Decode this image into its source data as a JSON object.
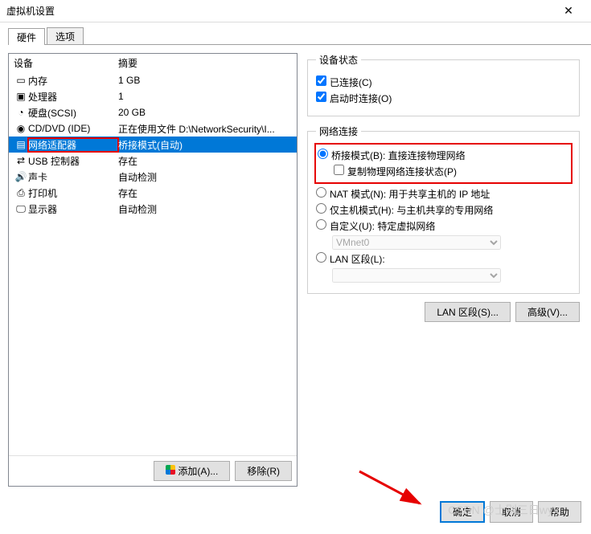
{
  "title": "虚拟机设置",
  "tabs": {
    "hardware": "硬件",
    "options": "选项"
  },
  "columns": {
    "device": "设备",
    "summary": "摘要"
  },
  "hardware": [
    {
      "icon": "memory",
      "device": "内存",
      "summary": "1 GB"
    },
    {
      "icon": "cpu",
      "device": "处理器",
      "summary": "1"
    },
    {
      "icon": "disk",
      "device": "硬盘(SCSI)",
      "summary": "20 GB"
    },
    {
      "icon": "cd",
      "device": "CD/DVD (IDE)",
      "summary": "正在使用文件 D:\\NetworkSecurity\\I..."
    },
    {
      "icon": "net",
      "device": "网络适配器",
      "summary": "桥接模式(自动)",
      "selected": true,
      "boxed": true
    },
    {
      "icon": "usb",
      "device": "USB 控制器",
      "summary": "存在"
    },
    {
      "icon": "sound",
      "device": "声卡",
      "summary": "自动检测"
    },
    {
      "icon": "printer",
      "device": "打印机",
      "summary": "存在"
    },
    {
      "icon": "display",
      "device": "显示器",
      "summary": "自动检测"
    }
  ],
  "buttons": {
    "add": "添加(A)...",
    "remove": "移除(R)",
    "lan": "LAN 区段(S)...",
    "advanced": "高级(V)..."
  },
  "status": {
    "legend": "设备状态",
    "connected": "已连接(C)",
    "connect_on_start": "启动时连接(O)"
  },
  "netconn": {
    "legend": "网络连接",
    "bridged": "桥接模式(B): 直接连接物理网络",
    "replicate": "复制物理网络连接状态(P)",
    "nat": "NAT 模式(N): 用于共享主机的 IP 地址",
    "hostonly": "仅主机模式(H): 与主机共享的专用网络",
    "custom": "自定义(U): 特定虚拟网络",
    "custom_net": "VMnet0",
    "lan": "LAN 区段(L):"
  },
  "dialog": {
    "ok": "确定",
    "cancel": "取消",
    "help": "帮助"
  },
  "watermark": "CSDN @士别三日wyx"
}
